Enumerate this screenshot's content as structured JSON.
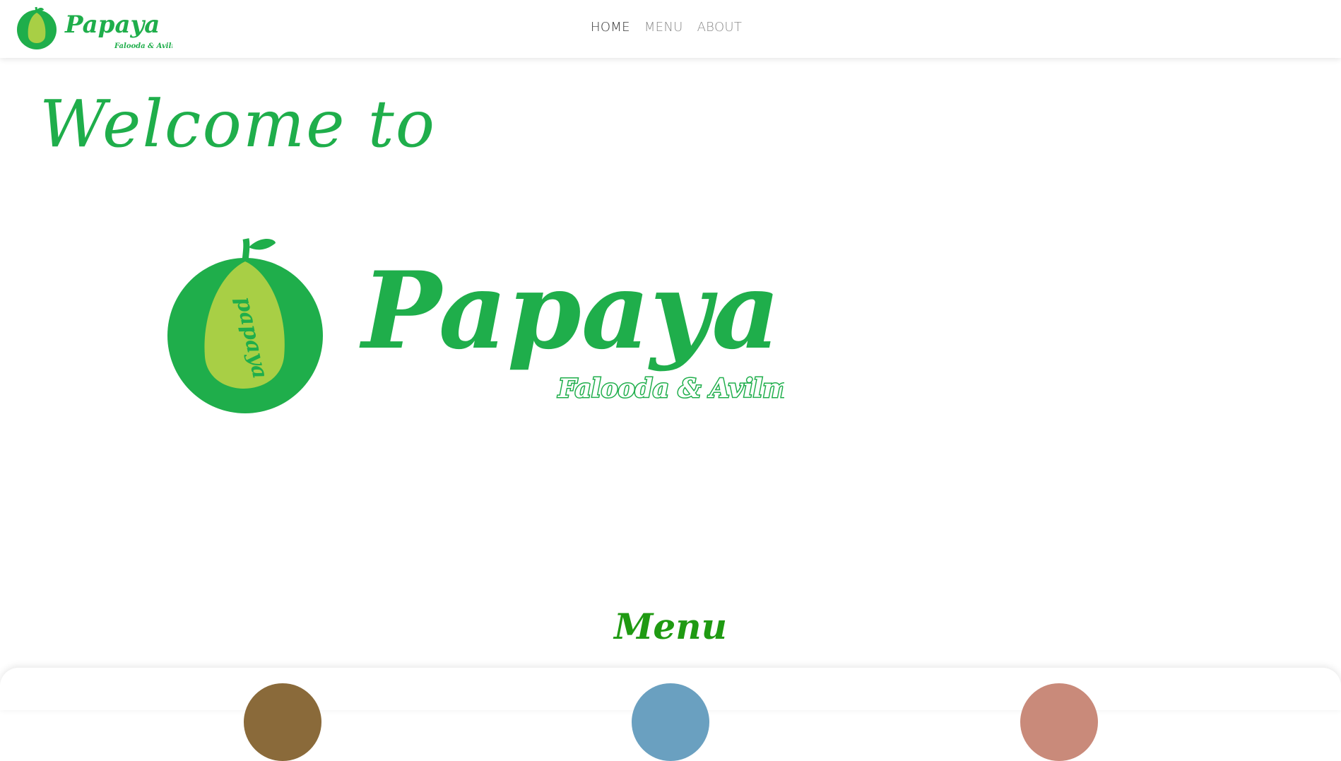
{
  "navbar": {
    "logo": {
      "name": "Papaya",
      "tagline": "Falooda & Avilmilk",
      "fruit_lettering": "papaya"
    },
    "links": [
      {
        "label": "HOME",
        "active": true
      },
      {
        "label": "MENU",
        "active": false
      },
      {
        "label": "ABOUT",
        "active": false
      }
    ]
  },
  "hero": {
    "welcome_text": "Welcome to",
    "logo": {
      "name": "Papaya",
      "tagline": "Falooda & Avilmilk",
      "fruit_lettering": "papaya"
    }
  },
  "menu": {
    "heading": "Menu",
    "items": [
      {
        "image": "menu-item-1-photo",
        "color": "#8a6a3a"
      },
      {
        "image": "menu-item-2-photo",
        "color": "#6aa0c0"
      },
      {
        "image": "menu-item-3-photo",
        "color": "#c98a7a"
      }
    ]
  },
  "colors": {
    "brand_green": "#1fae4b",
    "light_green": "#a8cf45",
    "menu_heading_green": "#1f9a12",
    "nav_text": "#8a8a8a",
    "nav_active": "#333333"
  }
}
